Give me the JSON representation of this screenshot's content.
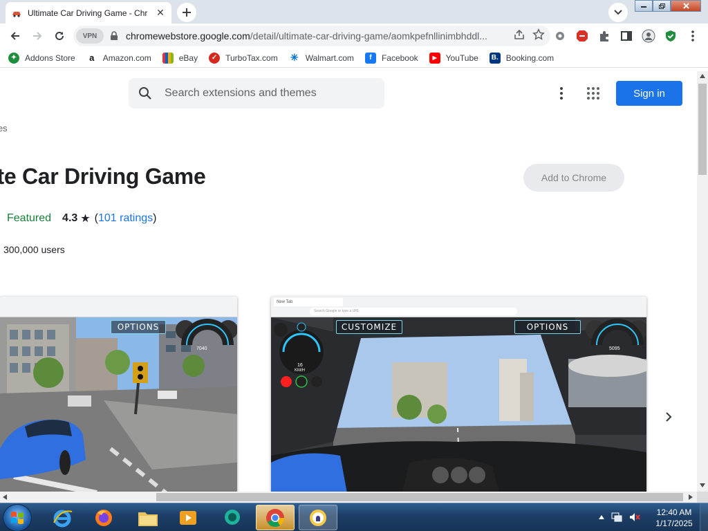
{
  "browser": {
    "tab_title": "Ultimate Car Driving Game - Chr",
    "url_host": "chromewebstore.google.com",
    "url_path": "/detail/ultimate-car-driving-game/aomkpefnllinimbhddl...",
    "vpn_label": "VPN"
  },
  "bookmarks": [
    {
      "label": "Addons Store",
      "icon": "addons-store-icon",
      "color": "#1e8e3e"
    },
    {
      "label": "Amazon.com",
      "icon": "amazon-icon",
      "color": "#111111"
    },
    {
      "label": "eBay",
      "icon": "ebay-icon",
      "color": "#e53238"
    },
    {
      "label": "TurboTax.com",
      "icon": "turbotax-icon",
      "color": "#d52b1e"
    },
    {
      "label": "Walmart.com",
      "icon": "walmart-icon",
      "color": "#0071ce"
    },
    {
      "label": "Facebook",
      "icon": "facebook-icon",
      "color": "#1877f2"
    },
    {
      "label": "YouTube",
      "icon": "youtube-icon",
      "color": "#ff0000"
    },
    {
      "label": "Booking.com",
      "icon": "booking-icon",
      "color": "#003580"
    }
  ],
  "store": {
    "search_placeholder": "Search extensions and themes",
    "signin_label": "Sign in",
    "breadcrumb": "mes",
    "title": "ate Car Driving Game",
    "add_button": "Add to Chrome",
    "featured_label": "Featured",
    "rating": "4.3",
    "star": "★",
    "ratings_link": "101 ratings",
    "users": "300,000 users",
    "screenshots": [
      {
        "label": "OPTIONS",
        "speed": "7040"
      },
      {
        "customize": "CUSTOMIZE",
        "label": "OPTIONS",
        "speed": "5095",
        "tab": "New Tab",
        "address": "Search Google or type a URL",
        "gear": "N",
        "speed_unit": "KM/H",
        "digital": "16"
      }
    ]
  },
  "taskbar": {
    "time": "12:40 AM",
    "date": "1/17/2025"
  },
  "colors": {
    "accent": "#1a73e8",
    "featured": "#188038",
    "title": "#202124"
  }
}
